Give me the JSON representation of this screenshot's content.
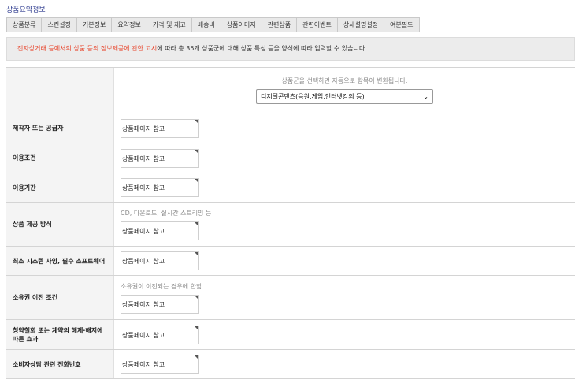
{
  "section_title": "상품요약정보",
  "tabs": [
    "상품분류",
    "스킨설정",
    "기본정보",
    "요약정보",
    "가격 및 재고",
    "배송비",
    "상품이미지",
    "관련상품",
    "관련이벤트",
    "상세설명설정",
    "여분필드"
  ],
  "notice": {
    "link": "전자상거래 등에서의 상품 등의 정보제공에 관한 고시",
    "rest": "에 따라 총 35개 상품군에 대해 상품 특성 등을 양식에 따라 입력할 수 있습니다."
  },
  "group": {
    "hint": "상품군을 선택하면 자동으로 항목이 변환됩니다.",
    "selected": "디지털콘텐츠(음원,게임,인터넷강의 등)"
  },
  "fields": [
    {
      "label": "제작자 또는 공급자",
      "hint": "",
      "value": "상품페이지 참고"
    },
    {
      "label": "이용조건",
      "hint": "",
      "value": "상품페이지 참고"
    },
    {
      "label": "이용기간",
      "hint": "",
      "value": "상품페이지 참고"
    },
    {
      "label": "상품 제공 방식",
      "hint": "CD, 다운로드, 실시간 스트리밍 등",
      "value": "상품페이지 참고"
    },
    {
      "label": "최소 시스템 사양, 필수 소프트웨어",
      "hint": "",
      "value": "상품페이지 참고"
    },
    {
      "label": "소유권 이전 조건",
      "hint": "소유권이 이전되는 경우에 한함",
      "value": "상품페이지 참고"
    },
    {
      "label": "청약철회 또는 계약의 해제·해지에 따른 효과",
      "hint": "",
      "value": "상품페이지 참고"
    },
    {
      "label": "소비자상담 관련 전화번호",
      "hint": "",
      "value": "상품페이지 참고"
    }
  ]
}
